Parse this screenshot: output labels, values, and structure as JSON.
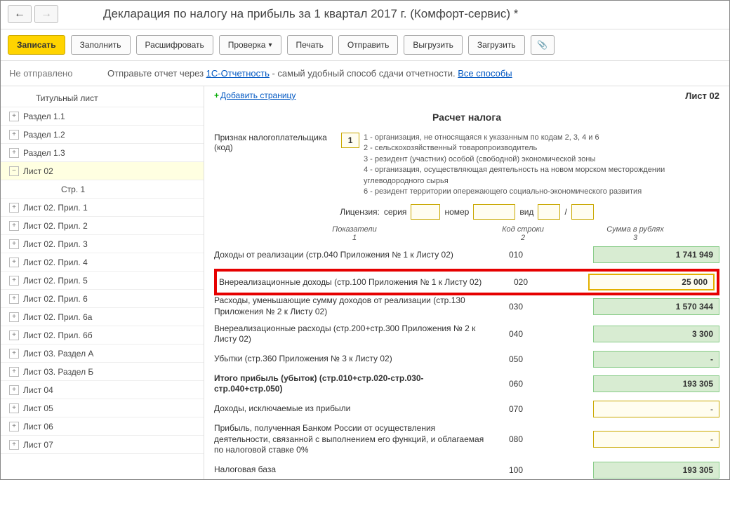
{
  "header": {
    "title": "Декларация по налогу на прибыль за 1 квартал 2017 г. (Комфорт-сервис) *"
  },
  "toolbar": {
    "write": "Записать",
    "fill": "Заполнить",
    "decipher": "Расшифровать",
    "check": "Проверка",
    "print": "Печать",
    "send": "Отправить",
    "unload": "Выгрузить",
    "load": "Загрузить"
  },
  "status": {
    "label": "Не отправлено",
    "hint_pre": "Отправьте отчет через ",
    "hint_link1": "1С-Отчетность",
    "hint_mid": " - самый удобный способ сдачи отчетности. ",
    "hint_link2": "Все способы"
  },
  "sidebar": {
    "items": [
      {
        "label": "Титульный лист",
        "level": 2,
        "expander": "none"
      },
      {
        "label": "Раздел 1.1",
        "level": 1,
        "expander": "plus"
      },
      {
        "label": "Раздел 1.2",
        "level": 1,
        "expander": "plus"
      },
      {
        "label": "Раздел 1.3",
        "level": 1,
        "expander": "plus"
      },
      {
        "label": "Лист 02",
        "level": 1,
        "expander": "minus",
        "selected": true
      },
      {
        "label": "Стр. 1",
        "level": 3,
        "expander": "none"
      },
      {
        "label": "Лист 02. Прил. 1",
        "level": 1,
        "expander": "plus"
      },
      {
        "label": "Лист 02. Прил. 2",
        "level": 1,
        "expander": "plus"
      },
      {
        "label": "Лист 02. Прил. 3",
        "level": 1,
        "expander": "plus"
      },
      {
        "label": "Лист 02. Прил. 4",
        "level": 1,
        "expander": "plus"
      },
      {
        "label": "Лист 02. Прил. 5",
        "level": 1,
        "expander": "plus"
      },
      {
        "label": "Лист 02. Прил. 6",
        "level": 1,
        "expander": "plus"
      },
      {
        "label": "Лист 02. Прил. 6а",
        "level": 1,
        "expander": "plus"
      },
      {
        "label": "Лист 02. Прил. 6б",
        "level": 1,
        "expander": "plus"
      },
      {
        "label": "Лист 03. Раздел А",
        "level": 1,
        "expander": "plus"
      },
      {
        "label": "Лист 03. Раздел Б",
        "level": 1,
        "expander": "plus"
      },
      {
        "label": "Лист 04",
        "level": 1,
        "expander": "plus"
      },
      {
        "label": "Лист 05",
        "level": 1,
        "expander": "plus"
      },
      {
        "label": "Лист 06",
        "level": 1,
        "expander": "plus"
      },
      {
        "label": "Лист 07",
        "level": 1,
        "expander": "plus"
      }
    ]
  },
  "content": {
    "add_page": "Добавить страницу",
    "sheet_label": "Лист 02",
    "sheet_title": "Расчет налога",
    "taxpayer_sign_label": "Признак налогоплательщика (код)",
    "taxpayer_sign_value": "1",
    "hints": [
      "1 - организация, не относящаяся к указанным по кодам 2, 3, 4 и 6",
      "2 - сельскохозяйственный товаропроизводитель",
      "3 - резидент (участник) особой (свободной) экономической зоны",
      "4 - организация, осуществляющая деятельность на новом морском месторождении углеводородного сырья",
      "6 - резидент территории опережающего социально-экономического развития"
    ],
    "license": {
      "prefix": "Лицензия:",
      "serial": "серия",
      "number": "номер",
      "type": "вид",
      "slash": "/"
    },
    "col_headers": {
      "c1a": "Показатели",
      "c1b": "1",
      "c2a": "Код строки",
      "c2b": "2",
      "c3a": "Сумма в рублях",
      "c3b": "3"
    },
    "rows": [
      {
        "label": "Доходы от реализации (стр.040 Приложения № 1 к Листу 02)",
        "code": "010",
        "value": "1 741 949",
        "style": "green"
      },
      {
        "label": "Внереализационные доходы (стр.100 Приложения № 1 к Листу 02)",
        "code": "020",
        "value": "25 000",
        "style": "highlight"
      },
      {
        "label": "Расходы, уменьшающие сумму доходов от реализации (стр.130 Приложения № 2 к Листу 02)",
        "code": "030",
        "value": "1 570 344",
        "style": "green"
      },
      {
        "label": "Внереализационные расходы (стр.200+стр.300 Приложения № 2 к Листу 02)",
        "code": "040",
        "value": "3 300",
        "style": "green"
      },
      {
        "label": "Убытки (стр.360 Приложения № 3 к Листу 02)",
        "code": "050",
        "value": "",
        "style": "green-empty"
      },
      {
        "label": "Итого прибыль (убыток)   (стр.010+стр.020-стр.030-стр.040+стр.050)",
        "code": "060",
        "value": "193 305",
        "style": "green",
        "bold": true
      },
      {
        "label": "Доходы, исключаемые из прибыли",
        "code": "070",
        "value": "",
        "style": "yellow-empty"
      },
      {
        "label": "Прибыль, полученная Банком России от осуществления деятельности, связанной с выполнением его функций, и облагаемая по налоговой ставке 0%",
        "code": "080",
        "value": "",
        "style": "yellow-empty"
      },
      {
        "label": "Налоговая база",
        "code": "100",
        "value": "193 305",
        "style": "green"
      }
    ]
  }
}
